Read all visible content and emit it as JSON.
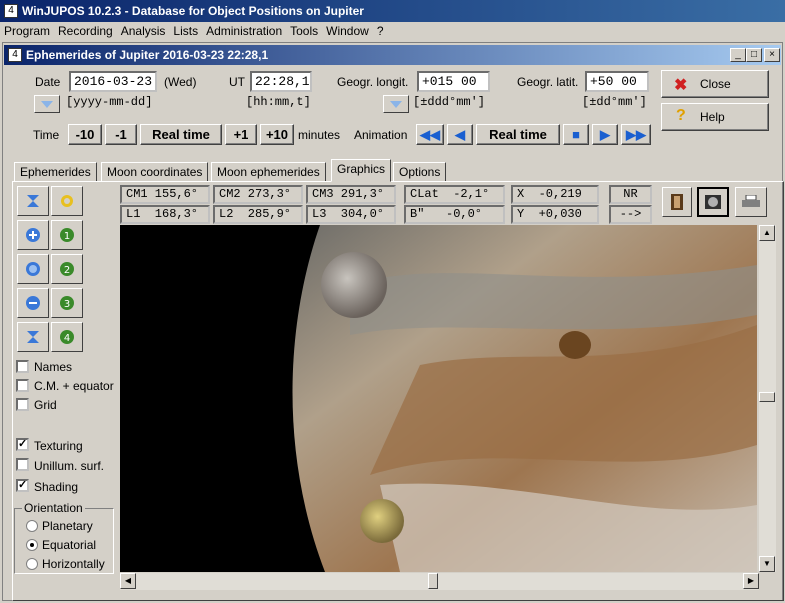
{
  "app_title": "WinJUPOS 10.2.3 - Database for Object Positions on Jupiter",
  "menu": [
    "Program",
    "Recording",
    "Analysis",
    "Lists",
    "Administration",
    "Tools",
    "Window",
    "?"
  ],
  "window_title": "Ephemerides of Jupiter  2016-03-23  22:28,1",
  "date": {
    "label": "Date",
    "value": "2016-03-23",
    "weekday": "(Wed)",
    "format": "[yyyy-mm-dd]"
  },
  "ut": {
    "label": "UT",
    "value": "22:28,1",
    "format": "[hh:mm,t]"
  },
  "longitude": {
    "label": "Geogr. longit.",
    "value": "+015 00",
    "format": "[±ddd°mm']"
  },
  "latitude": {
    "label": "Geogr. latit.",
    "value": "+50 00",
    "format": "[±dd°mm']"
  },
  "buttons": {
    "close": "Close",
    "help": "Help"
  },
  "time": {
    "label": "Time",
    "minus10": "-10",
    "minus1": "-1",
    "realtime": "Real time",
    "plus1": "+1",
    "plus10": "+10",
    "minutes": "minutes"
  },
  "animation": {
    "label": "Animation",
    "realtime": "Real time"
  },
  "tabs": [
    "Ephemerides",
    "Moon coordinates",
    "Moon ephemerides",
    "Graphics",
    "Options"
  ],
  "info": {
    "cm1": "CM1 155,6°",
    "cm2": "CM2 273,3°",
    "cm3": "CM3 291,3°",
    "clat": "CLat  -2,1°",
    "x": "X  -0,219",
    "nr": "NR",
    "l1": "L1  168,3°",
    "l2": "L2  285,9°",
    "l3": "L3  304,0°",
    "b": "B\"   -0,0°",
    "y": "Y  +0,030",
    "arrow": "-->"
  },
  "moon_buttons": [
    "1",
    "2",
    "3",
    "4"
  ],
  "options": {
    "names": "Names",
    "cm_equator": "C.M. + equator",
    "grid": "Grid",
    "texturing": "Texturing",
    "unillum": "Unillum. surf.",
    "shading": "Shading"
  },
  "checked": {
    "names": false,
    "cm_equator": false,
    "grid": false,
    "texturing": true,
    "unillum": false,
    "shading": true
  },
  "orientation": {
    "label": "Orientation",
    "planetary": "Planetary",
    "equatorial": "Equatorial",
    "horizontally": "Horizontally",
    "selected": "equatorial"
  },
  "colors": {
    "title_start": "#0a246a",
    "title_end": "#3a6ea5",
    "moon_button": "#3a8a2a",
    "close_x": "#d02020"
  }
}
